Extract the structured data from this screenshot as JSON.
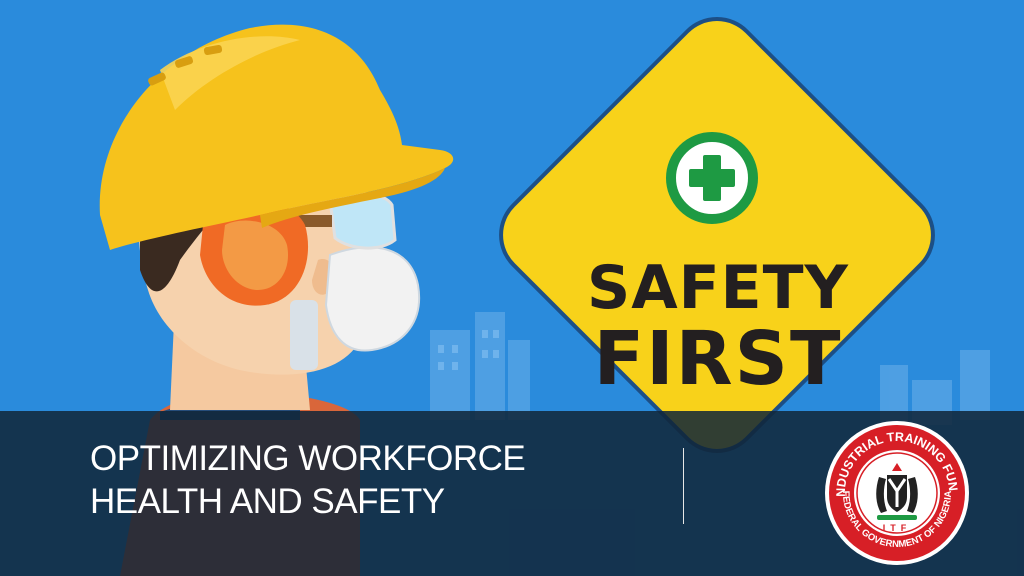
{
  "slide": {
    "title_line1": "OPTIMIZING WORKFORCE",
    "title_line2": "HEALTH AND SAFETY"
  },
  "sign": {
    "line1": "SAFETY",
    "line2": "FIRST",
    "icon": "green-cross-icon"
  },
  "logo": {
    "top_text": "INDUSTRIAL TRAINING FUND",
    "bottom_text": "FEDERAL GOVERNMENT OF NIGERIA",
    "monogram": "ITF"
  },
  "colors": {
    "background": "#2a8bdc",
    "helmet": "#f6c21c",
    "sign": "#f8d21a",
    "cross": "#1e9a43",
    "banner": "#102538",
    "logo_ring": "#d71f26"
  }
}
